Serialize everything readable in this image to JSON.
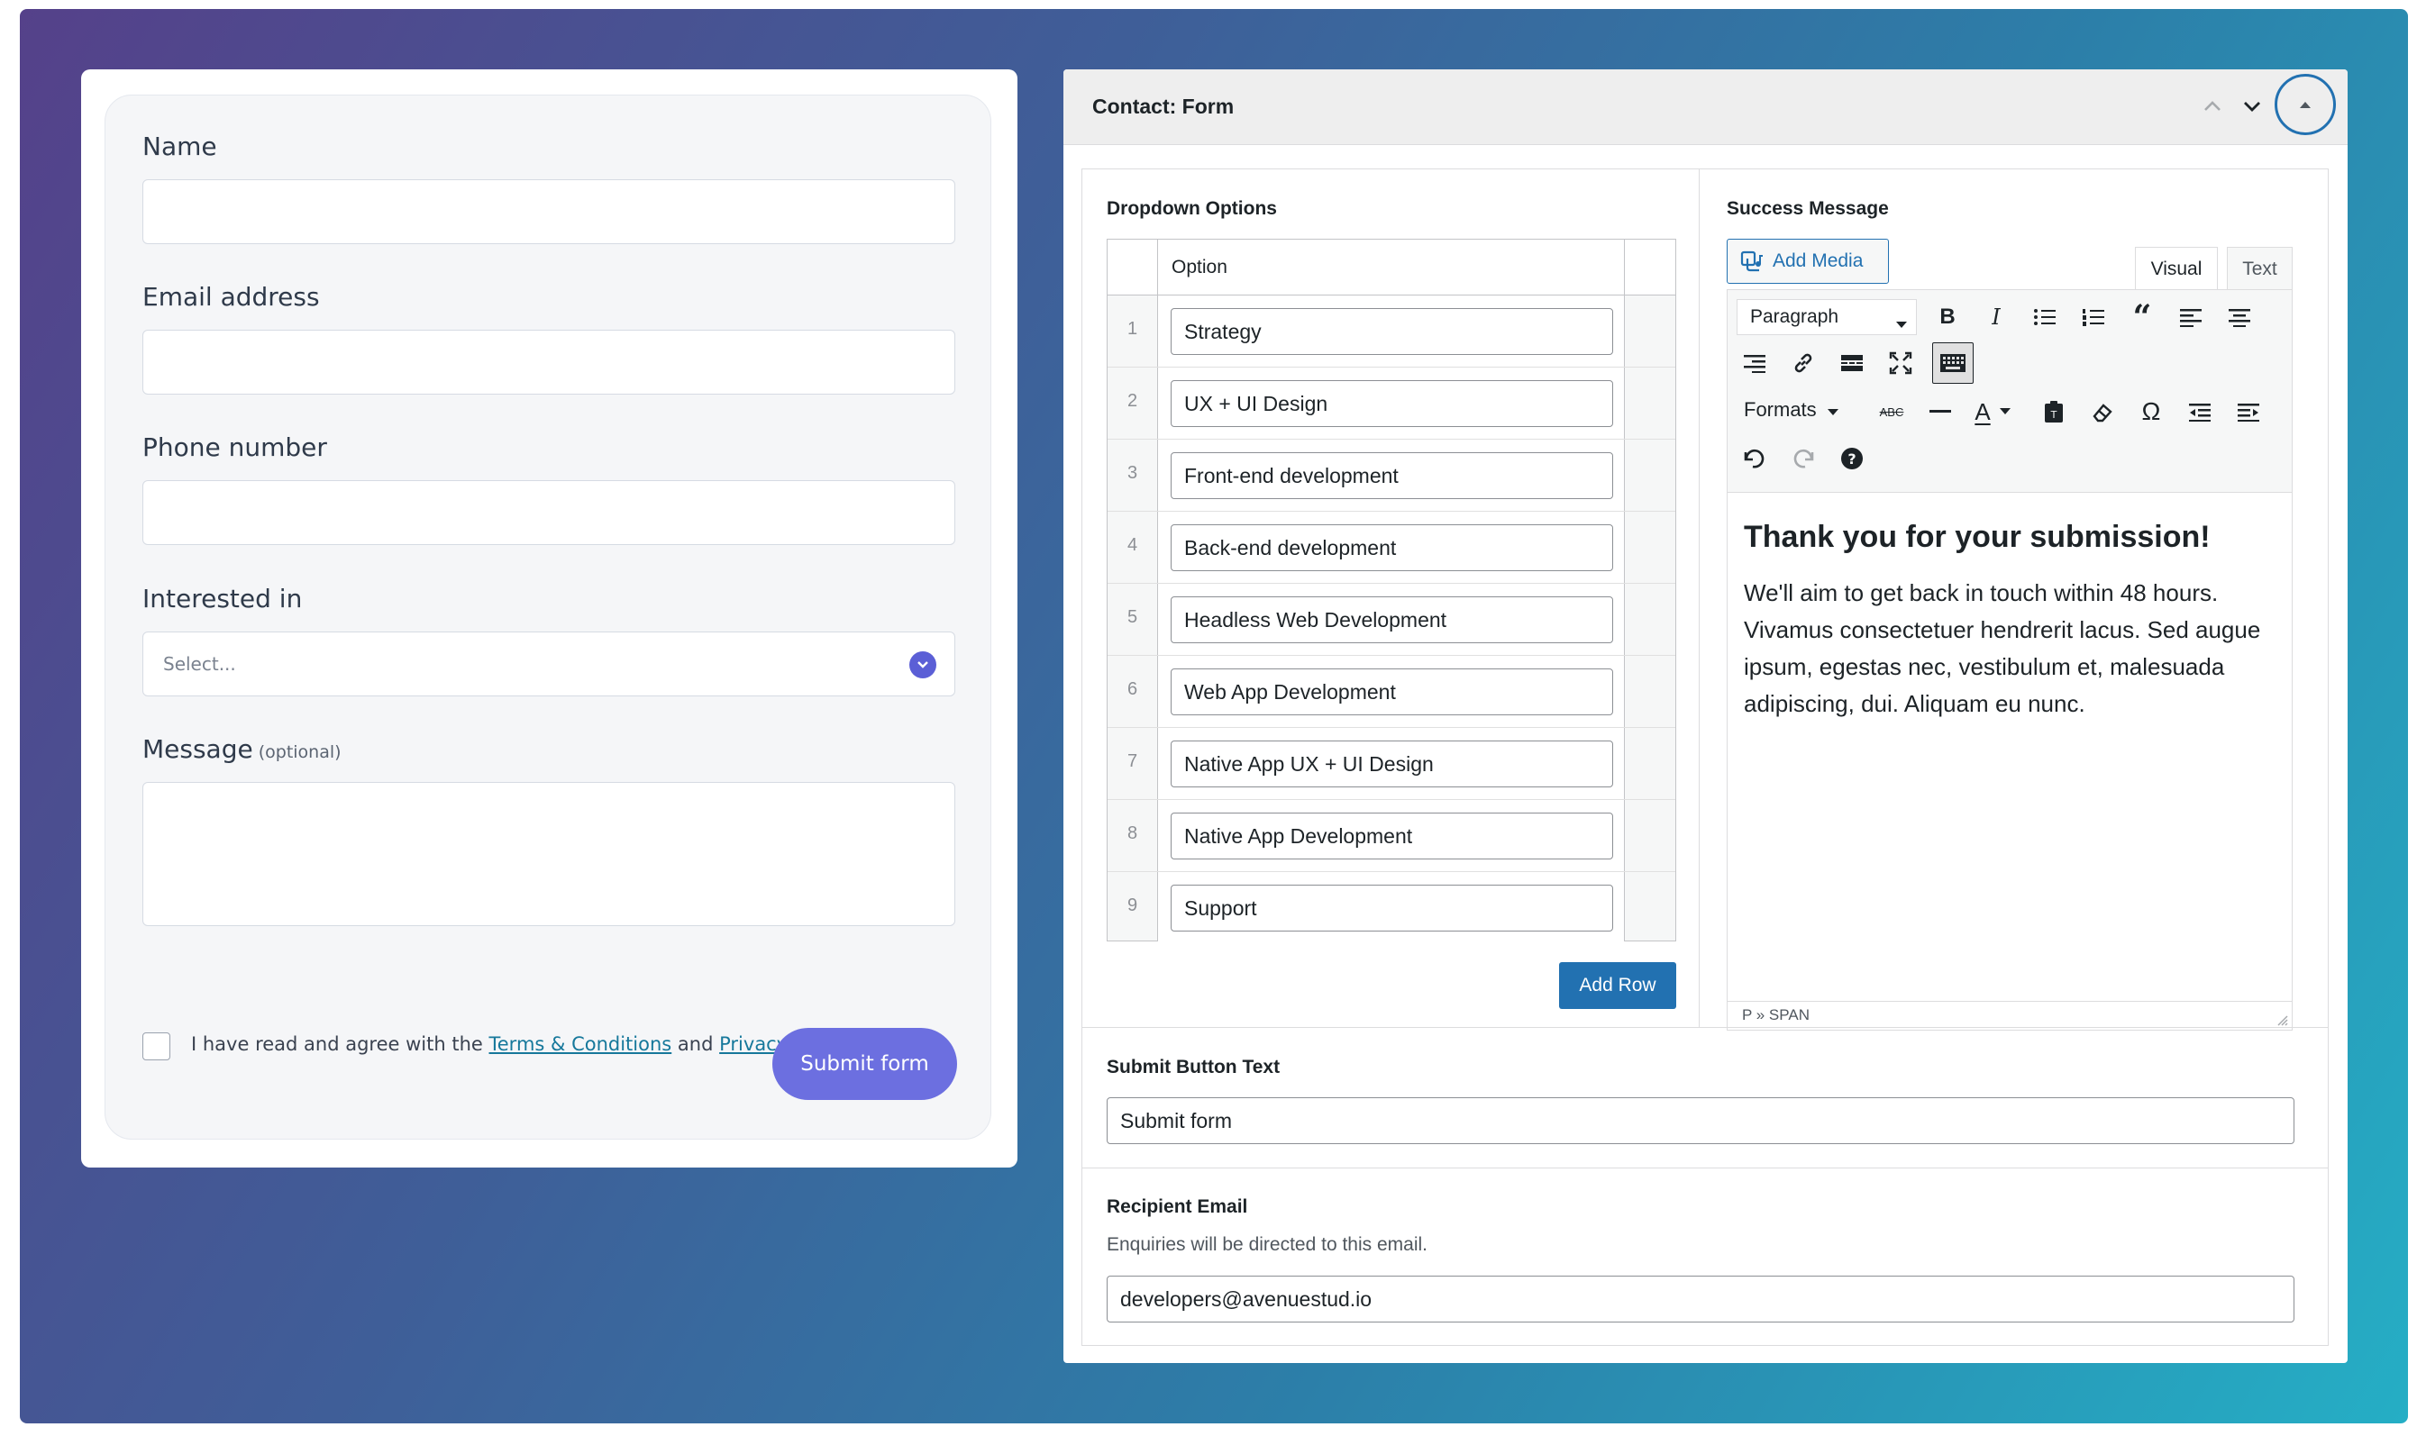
{
  "frontend_form": {
    "name_label": "Name",
    "email_label": "Email address",
    "phone_label": "Phone number",
    "interest_label": "Interested in",
    "interest_placeholder": "Select...",
    "message_label": "Message",
    "message_optional": "(optional)",
    "terms_prefix": "I have read and agree with the",
    "terms_link": "Terms & Conditions",
    "terms_and": "and",
    "privacy_link": "Privacy Policy",
    "terms_suffix": ".",
    "submit_label": "Submit form",
    "accent_color": "#6c6fe0"
  },
  "panel": {
    "title": "Contact: Form",
    "dropdown": {
      "label": "Dropdown Options",
      "column_header": "Option",
      "rows": [
        {
          "num": "1",
          "value": "Strategy"
        },
        {
          "num": "2",
          "value": "UX + UI Design"
        },
        {
          "num": "3",
          "value": "Front-end development"
        },
        {
          "num": "4",
          "value": "Back-end development"
        },
        {
          "num": "5",
          "value": "Headless Web Development"
        },
        {
          "num": "6",
          "value": "Web App Development"
        },
        {
          "num": "7",
          "value": "Native App UX + UI Design"
        },
        {
          "num": "8",
          "value": "Native App Development"
        },
        {
          "num": "9",
          "value": "Support"
        }
      ],
      "add_row_label": "Add Row"
    },
    "success": {
      "label": "Success Message",
      "add_media_label": "Add Media",
      "tab_visual": "Visual",
      "tab_text": "Text",
      "paragraph_select": "Paragraph",
      "formats_label": "Formats",
      "heading": "Thank you for your submission!",
      "body": "We'll aim to get back in touch within 48 hours. Vivamus consectetuer hendrerit lacus. Sed augue ipsum, egestas nec, vestibulum et, malesuada adipiscing, dui. Aliquam eu nunc.",
      "status_path": "P » SPAN"
    },
    "submit_text": {
      "label": "Submit Button Text",
      "value": "Submit form"
    },
    "recipient": {
      "label": "Recipient Email",
      "description": "Enquiries will be directed to this email.",
      "value": "developers@avenuestud.io"
    },
    "primary_color": "#2271b1"
  }
}
